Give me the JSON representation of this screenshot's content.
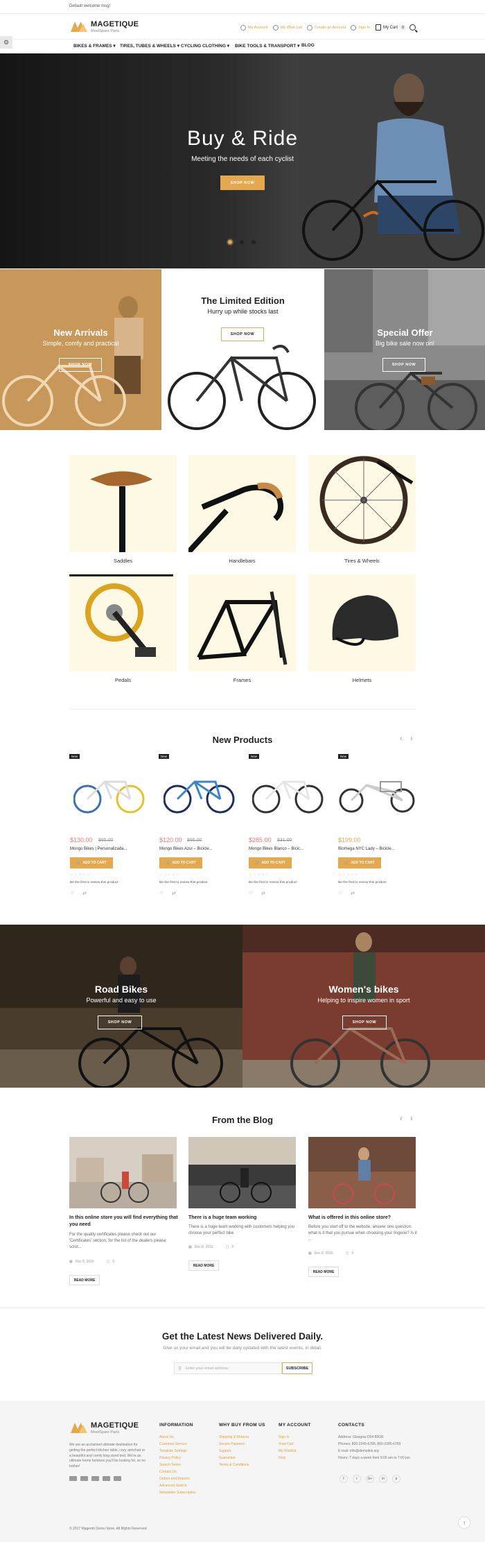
{
  "topbar": {
    "welcome": "Default welcome msg!"
  },
  "header": {
    "logo_name": "MAGETIQUE",
    "logo_sub": "MeetSpare Parts",
    "util": [
      "My Account",
      "My Wish List",
      "Create an Account",
      "Sign In"
    ],
    "cart_label": "My Cart",
    "cart_count": "0"
  },
  "nav": [
    "BIKES & FRAMES",
    "TIRES, TUBES & WHEELS",
    "CYCLING CLOTHING",
    "BIKE TOOLS & TRANSPORT",
    "BLOG"
  ],
  "hero": {
    "title": "Buy & Ride",
    "subtitle": "Meeting the needs of each cyclist",
    "button": "SHOP NOW"
  },
  "promos": [
    {
      "title": "New Arrivals",
      "subtitle": "Simple, comfy and practical",
      "button": "SHOP NOW"
    },
    {
      "title": "The Limited Edition",
      "subtitle": "Hurry up while stocks last",
      "button": "SHOP NOW"
    },
    {
      "title": "Special Offer",
      "subtitle": "Big bike sale now on!",
      "button": "SHOP NOW"
    }
  ],
  "categories": [
    "Saddles",
    "Handlebars",
    "Tires & Wheels",
    "Pedals",
    "Frames",
    "Helmets"
  ],
  "new_products": {
    "title": "New Products",
    "items": [
      {
        "badge": "New",
        "price": "$130.00",
        "old_price": "$65.00",
        "name": "Mongo Bikes | Personalizada...",
        "button": "ADD TO CART",
        "review": "Be the first to review this product"
      },
      {
        "badge": "New",
        "price": "$120.00",
        "old_price": "$65.00",
        "name": "Mongo Bikes Azul – Bicicle...",
        "button": "ADD TO CART",
        "review": "Be the first to review this product"
      },
      {
        "badge": "New",
        "price": "$285.00",
        "old_price": "$31.00",
        "name": "Mongo Bikes Blanco – Bicic...",
        "button": "ADD TO CART",
        "review": "Be the first to review this product"
      },
      {
        "badge": "New",
        "price": "$199.00",
        "old_price": "",
        "name": "Biomega NYC Lady – Bicicle...",
        "button": "ADD TO CART",
        "review": "Be the first to review this product"
      }
    ]
  },
  "bike_banners": [
    {
      "title": "Road Bikes",
      "subtitle": "Powerful and easy to use",
      "button": "SHOP NOW"
    },
    {
      "title": "Women's bikes",
      "subtitle": "Helping to inspire women in sport",
      "button": "SHOP NOW"
    }
  ],
  "blog": {
    "title": "From the Blog",
    "posts": [
      {
        "title": "In this online store you will find everything that you need",
        "excerpt": "For the quality certificates please check out our 'Certificates' section, for the list of the dealers please scrol...",
        "date": "Dec 8, 2016",
        "comments": "0",
        "button": "READ MORE"
      },
      {
        "title": "There is a huge team working",
        "excerpt": "There is a huge team working with customers helping you choose your perfect bike",
        "date": "Dec 8, 2016",
        "comments": "0",
        "button": "READ MORE"
      },
      {
        "title": "What is offered in this online store?",
        "excerpt": "Before you start off to the website, answer one question: what is it that you pursue when choosing your lingerie? Is it ...",
        "date": "Dec 8, 2016",
        "comments": "0",
        "button": "READ MORE"
      }
    ]
  },
  "newsletter": {
    "title": "Get the Latest News Delivered Daily.",
    "subtitle": "Give us your email and you will be daily updated with the latest events, in detail.",
    "placeholder": "Enter your email address",
    "button": "SUBSCRIBE"
  },
  "footer": {
    "logo_name": "MAGETIQUE",
    "logo_sub": "MeetSpare Parts",
    "about": "We are an acclaimed ultimate destination for getting the perfect kitchen table, cozy armchair or a beautiful and comfy king sized bed. We're an ultimate home furniture you'll be looking for, so no bother!",
    "columns": [
      {
        "heading": "INFORMATION",
        "links": [
          "About Us",
          "Customer Service",
          "Template Settings",
          "Privacy Policy",
          "Search Terms",
          "Contact Us",
          "Orders and Returns",
          "Advanced Search",
          "Newsletter Subscription"
        ]
      },
      {
        "heading": "WHY BUY FROM US",
        "links": [
          "Shipping & Returns",
          "Secure Payment",
          "Support",
          "Guarantee",
          "Terms & Conditions"
        ]
      },
      {
        "heading": "MY ACCOUNT",
        "links": [
          "Sign In",
          "View Cart",
          "My Wishlist",
          "Help"
        ]
      }
    ],
    "contacts_heading": "CONTACTS",
    "contacts": [
      "Address: Glasgow D04 89GR",
      "Phones: 800-2345-6789, 800-2345-6789",
      "E-mail: info@demolink.org",
      "Hours: 7 days a week from 9:00 am to 7:00 pm"
    ],
    "social": [
      "f",
      "t",
      "G+",
      "in",
      "p"
    ],
    "copyright": "© 2017 Magento Demo Store. All Rights Reserved."
  },
  "colors": {
    "accent": "#e4a84f",
    "price": "#e87a7a",
    "cream": "#fdf9e4"
  }
}
